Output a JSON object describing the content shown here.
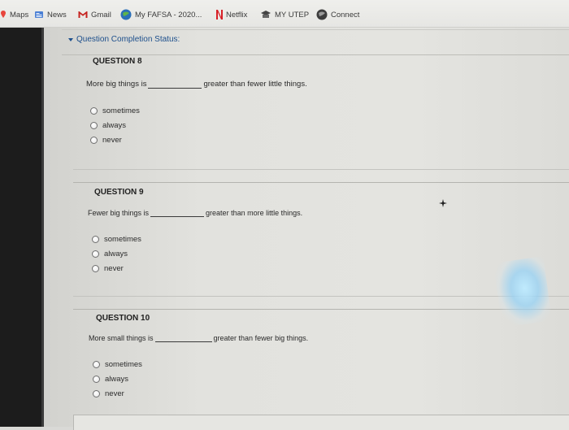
{
  "bookmarks": {
    "items": [
      {
        "label": "Maps",
        "icon": "maps-pin-icon"
      },
      {
        "label": "News",
        "icon": "news-icon"
      },
      {
        "label": "Gmail",
        "icon": "gmail-icon"
      },
      {
        "label": "My FAFSA - 2020...",
        "icon": "fafsa-globe-icon"
      },
      {
        "label": "Netflix",
        "icon": "netflix-icon"
      },
      {
        "label": "MY UTEP",
        "icon": "utep-icon"
      },
      {
        "label": "Connect",
        "icon": "connect-globe-icon"
      }
    ]
  },
  "status": {
    "label": "Question Completion Status:"
  },
  "questions": [
    {
      "title": "QUESTION 8",
      "stem_before": "More big things is",
      "stem_after": "greater than fewer little things.",
      "options": [
        "sometimes",
        "always",
        "never"
      ]
    },
    {
      "title": "QUESTION 9",
      "stem_before": "Fewer big things is",
      "stem_after": "greater than more little things.",
      "options": [
        "sometimes",
        "always",
        "never"
      ]
    },
    {
      "title": "QUESTION 10",
      "stem_before": "More small things is",
      "stem_after": "greater than fewer big things.",
      "options": [
        "sometimes",
        "always",
        "never"
      ]
    }
  ],
  "colors": {
    "link_blue": "#1d4f8c",
    "netflix_red": "#d81f26",
    "gmail_red": "#c5221f"
  }
}
